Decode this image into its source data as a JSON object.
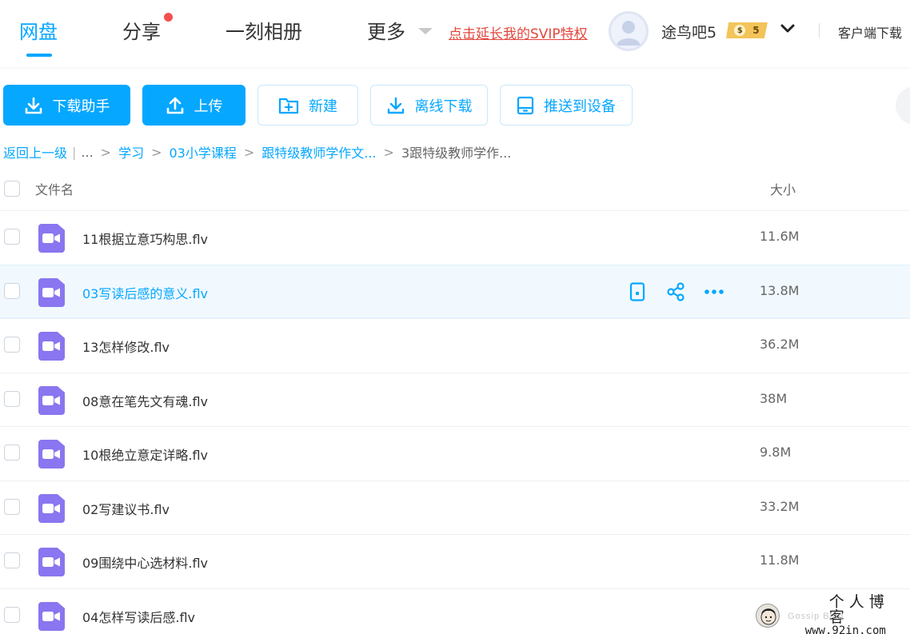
{
  "nav": {
    "tabs": [
      "网盘",
      "分享",
      "一刻相册",
      "更多"
    ],
    "active_tab": "网盘",
    "vip_promo": "点击延长我的SVIP特权",
    "username": "途鸟吧5",
    "vip_level": "5",
    "client_download": "客户端下载"
  },
  "toolbar": {
    "download_helper": "下载助手",
    "upload": "上传",
    "new": "新建",
    "offline_download": "离线下载",
    "push_to_device": "推送到设备"
  },
  "breadcrumb": {
    "back": "返回上一级",
    "bar": "|",
    "ellipsis": "...",
    "items": [
      "学习",
      "03小学课程",
      "跟特级教师学作文..."
    ],
    "current": "3跟特级教师学作...",
    "separator": ">"
  },
  "list": {
    "header_name": "文件名",
    "header_size": "大小",
    "rows": [
      {
        "name": "11根据立意巧构思.flv",
        "size": "11.6M"
      },
      {
        "name": "03写读后感的意义.flv",
        "size": "13.8M"
      },
      {
        "name": "13怎样修改.flv",
        "size": "36.2M"
      },
      {
        "name": "08意在笔先文有魂.flv",
        "size": "38M"
      },
      {
        "name": "10根绝立意定详略.flv",
        "size": "9.8M"
      },
      {
        "name": "02写建议书.flv",
        "size": "33.2M"
      },
      {
        "name": "09围绕中心选材料.flv",
        "size": "11.8M"
      },
      {
        "name": "04怎样写读后感.flv",
        "size": ""
      }
    ],
    "hovered_row": 1
  },
  "watermark": {
    "title": "个人博客",
    "url": "www.92in.com",
    "faint": "Gossip Blog"
  },
  "colors": {
    "accent": "#06a7ff",
    "vip_red": "#e2473d",
    "video_icon": "#8976f0",
    "hover_row": "#f1f9ff"
  }
}
